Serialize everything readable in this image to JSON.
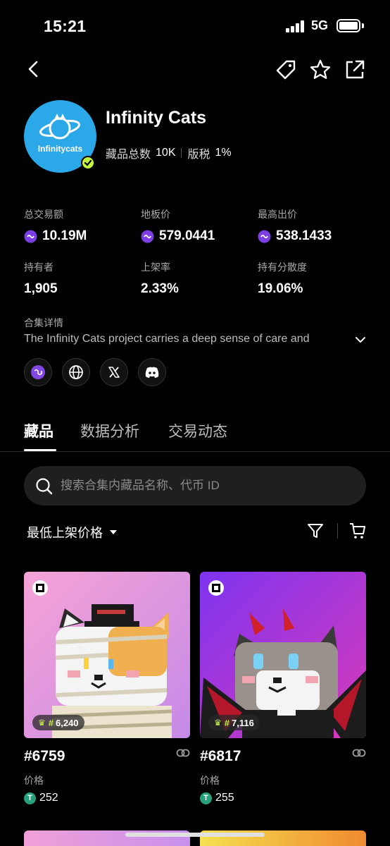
{
  "status_bar": {
    "time": "15:21",
    "network": "5G"
  },
  "collection": {
    "name": "Infinity Cats",
    "avatar_text": "Infinitycats",
    "total_items_label": "藏品总数",
    "total_items": "10K",
    "royalty_label": "版税",
    "royalty": "1%"
  },
  "stats": [
    {
      "label": "总交易额",
      "value": "10.19M",
      "coin": true
    },
    {
      "label": "地板价",
      "value": "579.0441",
      "coin": true
    },
    {
      "label": "最高出价",
      "value": "538.1433",
      "coin": true
    },
    {
      "label": "持有者",
      "value": "1,905",
      "coin": false
    },
    {
      "label": "上架率",
      "value": "2.33%",
      "coin": false
    },
    {
      "label": "持有分散度",
      "value": "19.06%",
      "coin": false
    }
  ],
  "details": {
    "label": "合集详情",
    "text": "The Infinity Cats project carries a deep sense of care and"
  },
  "social": [
    "polygon-icon",
    "globe-icon",
    "x-icon",
    "discord-icon"
  ],
  "tabs": [
    {
      "label": "藏品",
      "active": true
    },
    {
      "label": "数据分析",
      "active": false
    },
    {
      "label": "交易动态",
      "active": false
    }
  ],
  "search": {
    "placeholder": "搜索合集内藏品名称、代币 ID"
  },
  "sort": {
    "label": "最低上架价格"
  },
  "cards": [
    {
      "title": "#6759",
      "rank": "6,240",
      "price_label": "价格",
      "price": "252"
    },
    {
      "title": "#6817",
      "rank": "7,116",
      "price_label": "价格",
      "price": "255"
    }
  ],
  "colors": {
    "accent": "#c3f53c",
    "coin": "#7b3fe4",
    "usdt": "#26a17b",
    "background": "#000000"
  }
}
